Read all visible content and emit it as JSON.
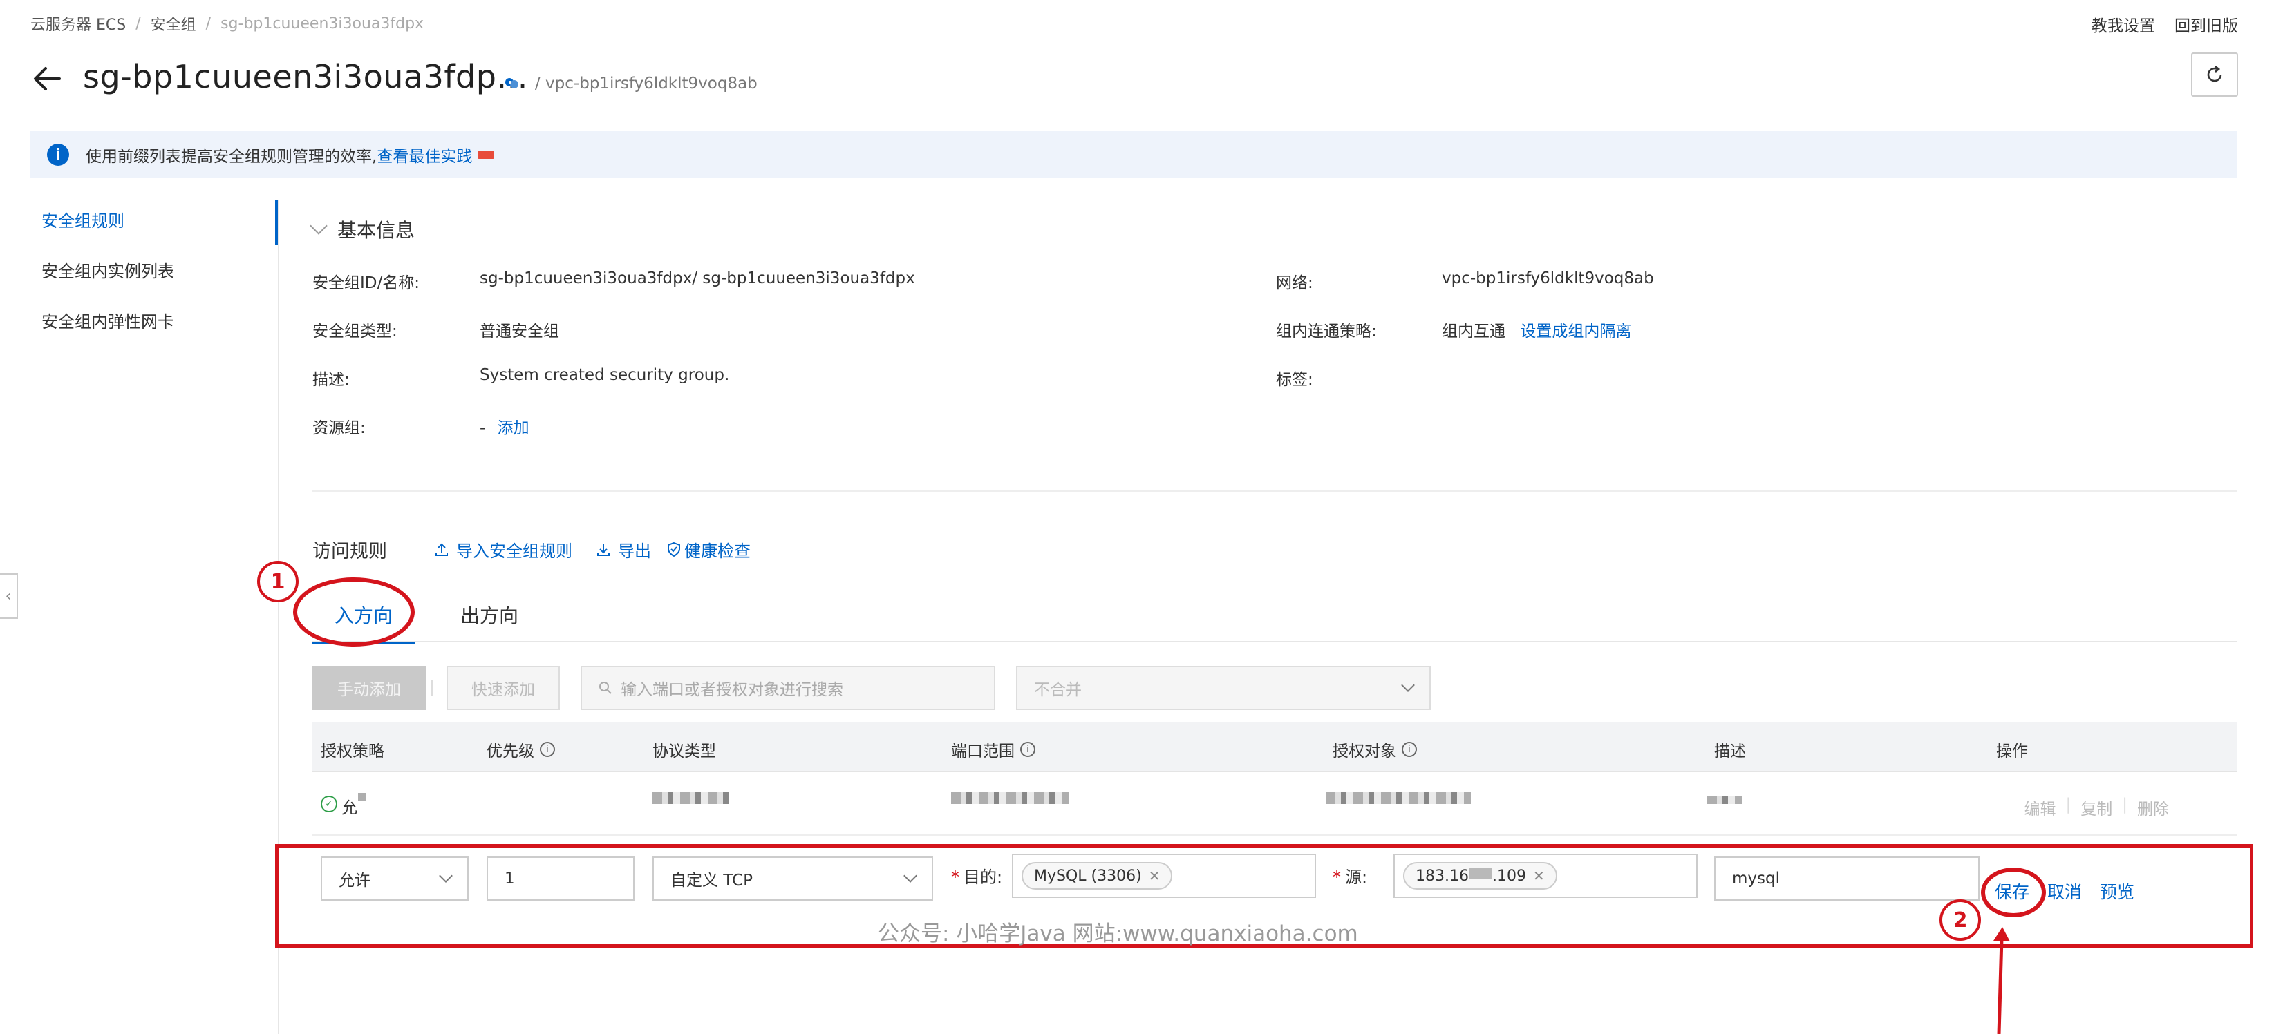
{
  "breadcrumb": {
    "item1": "云服务器 ECS",
    "sep": "/",
    "item2": "安全组",
    "item3": "sg-bp1cuueen3i3oua3fdpx"
  },
  "top_links": {
    "tutorial": "教我设置",
    "old_version": "回到旧版"
  },
  "header": {
    "title": "sg-bp1cuueen3i3oua3fdp...",
    "vpc": "/ vpc-bp1irsfy6ldklt9voq8ab"
  },
  "banner": {
    "text": "使用前缀列表提高安全组规则管理的效率,",
    "link": "查看最佳实践"
  },
  "left_nav": {
    "items": [
      "安全组规则",
      "安全组内实例列表",
      "安全组内弹性网卡"
    ]
  },
  "basic_info": {
    "title": "基本信息",
    "sg_id_label": "安全组ID/名称:",
    "sg_id_value": "sg-bp1cuueen3i3oua3fdpx/ sg-bp1cuueen3i3oua3fdpx",
    "sg_type_label": "安全组类型:",
    "sg_type_value": "普通安全组",
    "desc_label": "描述:",
    "desc_value": "System created security group.",
    "rg_label": "资源组:",
    "rg_value": "-",
    "rg_add": "添加",
    "network_label": "网络:",
    "network_value": "vpc-bp1irsfy6ldklt9voq8ab",
    "policy_label": "组内连通策略:",
    "policy_value": "组内互通",
    "policy_link": "设置成组内隔离",
    "tags_label": "标签:"
  },
  "rules": {
    "title": "访问规则",
    "actions": [
      "导入安全组规则",
      "导出",
      "健康检查"
    ],
    "tabs": [
      "入方向",
      "出方向"
    ]
  },
  "toolbar": {
    "manual_add": "手动添加",
    "quick_add": "快速添加",
    "search_placeholder": "输入端口或者授权对象进行搜索",
    "merge_select": "不合并"
  },
  "table": {
    "headers": [
      "授权策略",
      "优先级",
      "协议类型",
      "端口范围",
      "授权对象",
      "描述",
      "操作"
    ],
    "row1": {
      "policy": "允",
      "ops": [
        "编辑",
        "复制",
        "删除"
      ]
    }
  },
  "edit_row": {
    "policy": "允许",
    "priority": "1",
    "protocol": "自定义 TCP",
    "dest_label": "目的:",
    "dest_tag": "MySQL (3306)",
    "src_label": "源:",
    "src_tag": "183.16",
    "src_tag_tail": ".109",
    "desc": "mysql",
    "ops": [
      "保存",
      "取消",
      "预览"
    ]
  },
  "watermark": "公众号: 小哈学Java  网站:www.quanxiaoha.com",
  "annotations": {
    "step1": "1",
    "step2": "2"
  },
  "colors": {
    "accent": "#0064c8",
    "annotation_red": "#d4141c",
    "success": "#2e9e48"
  }
}
